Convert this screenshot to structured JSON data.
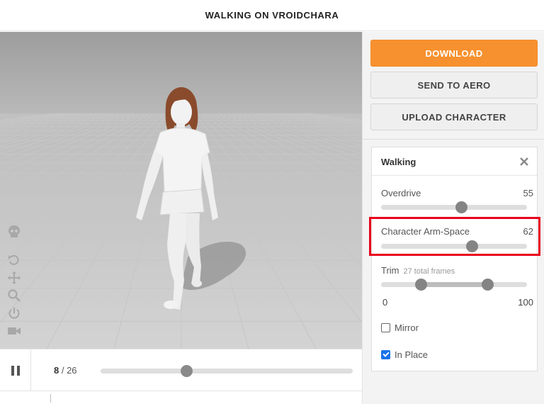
{
  "header": {
    "title": "WALKING ON VROIDCHARA"
  },
  "viewport": {
    "tools": [
      "skull-icon",
      "undo-rotate-icon",
      "move-icon",
      "zoom-icon",
      "power-icon",
      "camera-icon"
    ]
  },
  "playback": {
    "current_frame": "8",
    "separator": " / ",
    "total_frames": "26",
    "position": 0.34
  },
  "actions": {
    "download": "DOWNLOAD",
    "send_to_aero": "SEND TO AERO",
    "upload_character": "UPLOAD CHARACTER",
    "download_color": "#f7912f"
  },
  "animation": {
    "name": "Walking",
    "params": [
      {
        "label": "Overdrive",
        "value": "55",
        "fraction": 0.55
      },
      {
        "label": "Character Arm-Space",
        "value": "62",
        "fraction": 0.62
      }
    ],
    "trim": {
      "label": "Trim",
      "subtitle": "27 total frames",
      "min_label": "0",
      "max_label": "100",
      "start_fraction": 0.27,
      "end_fraction": 0.73
    },
    "mirror": {
      "label": "Mirror",
      "checked": false
    },
    "in_place": {
      "label": "In Place",
      "checked": true
    }
  },
  "colors": {
    "highlight": "#e8001c",
    "checkbox_on": "#1a73e8"
  }
}
